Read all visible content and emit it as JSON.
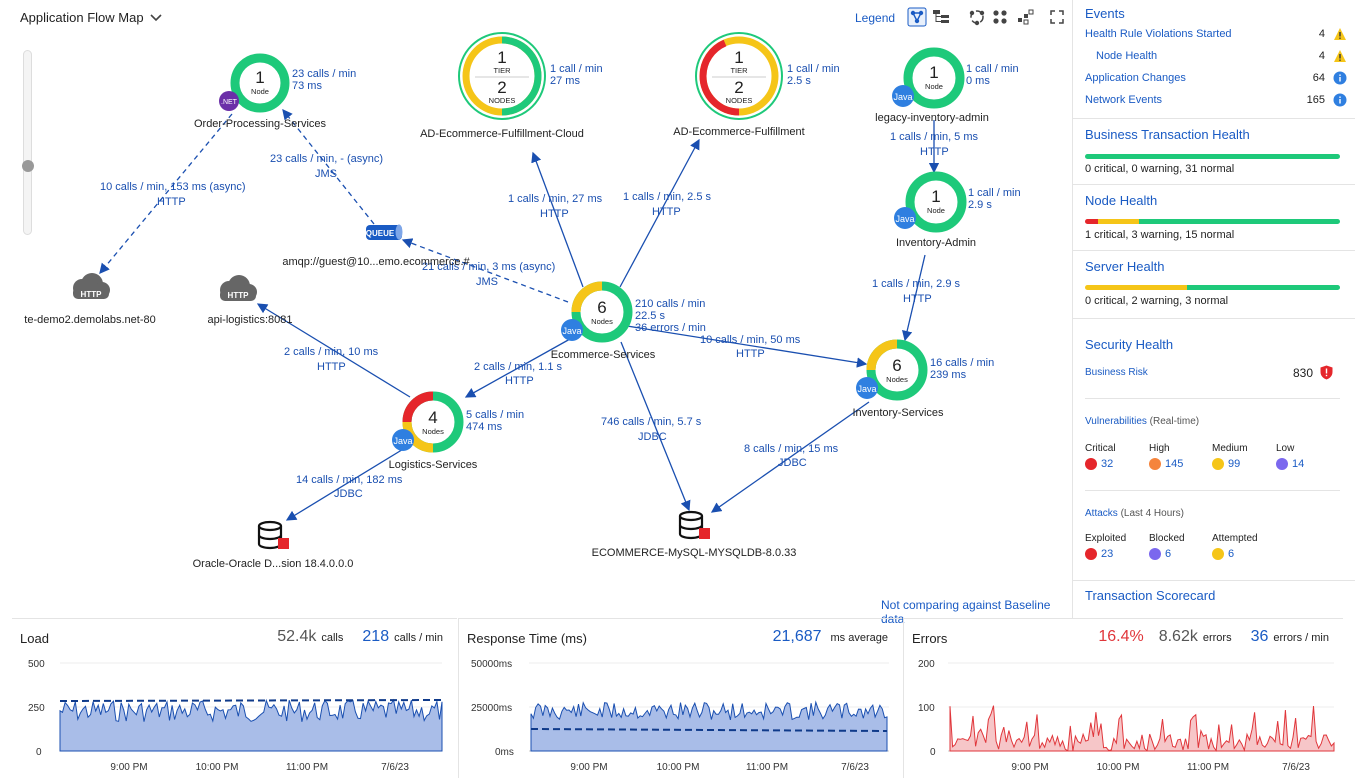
{
  "map": {
    "title": "Application Flow Map",
    "legend": "Legend",
    "baseline_note": "Not comparing against Baseline data",
    "nodes": {
      "order": {
        "count": "1",
        "unit": "Node",
        "name": "Order-Processing-Services",
        "badge": ".NET",
        "stats": [
          "23 calls / min",
          "73 ms"
        ]
      },
      "cloud": {
        "tier": "1",
        "tier_label": "TIER",
        "nodes": "2",
        "nodes_label": "NODES",
        "name": "AD-Ecommerce-Fulfillment-Cloud",
        "stats": [
          "1 call / min",
          "27 ms"
        ]
      },
      "fulfill": {
        "tier": "1",
        "tier_label": "TIER",
        "nodes": "2",
        "nodes_label": "NODES",
        "name": "AD-Ecommerce-Fulfillment",
        "stats": [
          "1 call / min",
          "2.5 s"
        ]
      },
      "legacy": {
        "count": "1",
        "unit": "Node",
        "name": "legacy-inventory-admin",
        "badge": "Java",
        "stats": [
          "1 call / min",
          "0 ms"
        ]
      },
      "invadmin": {
        "count": "1",
        "unit": "Node",
        "name": "Inventory-Admin",
        "badge": "Java",
        "stats": [
          "1 call / min",
          "2.9 s"
        ]
      },
      "ecom": {
        "count": "6",
        "unit": "Nodes",
        "name": "Ecommerce-Services",
        "badge": "Java",
        "stats": [
          "210 calls / min",
          "22.5 s",
          "36 errors / min"
        ]
      },
      "invsvc": {
        "count": "6",
        "unit": "Nodes",
        "name": "Inventory-Services",
        "badge": "Java",
        "stats": [
          "16 calls / min",
          "239 ms"
        ]
      },
      "logistics": {
        "count": "4",
        "unit": "Nodes",
        "name": "Logistics-Services",
        "badge": "Java",
        "stats": [
          "5 calls / min",
          "474 ms"
        ]
      },
      "queue": {
        "label": "QUEUE",
        "name": "amqp://guest@10...emo.ecommerce.#"
      },
      "http1": {
        "label": "HTTP",
        "name": "te-demo2.demolabs.net-80"
      },
      "http2": {
        "label": "HTTP",
        "name": "api-logistics:8081"
      },
      "oracle": {
        "name": "Oracle-Oracle D...sion 18.4.0.0.0"
      },
      "mysql": {
        "name": "ECOMMERCE-MySQL-MYSQLDB-8.0.33"
      }
    },
    "edges": {
      "e1": [
        "10 calls / min, 153 ms (async)",
        "HTTP"
      ],
      "e2": [
        "23 calls / min, - (async)",
        "JMS"
      ],
      "e3": [
        "21 calls / min, 3 ms (async)",
        "JMS"
      ],
      "e4": [
        "1 calls / min, 27 ms",
        "HTTP"
      ],
      "e5": [
        "1 calls / min, 2.5 s",
        "HTTP"
      ],
      "e6": [
        "1 calls / min, 5 ms",
        "HTTP"
      ],
      "e7": [
        "1 calls / min, 2.9 s",
        "HTTP"
      ],
      "e8": [
        "10 calls / min, 50 ms",
        "HTTP"
      ],
      "e9": [
        "2 calls / min, 10 ms",
        "HTTP"
      ],
      "e10": [
        "2 calls / min, 1.1 s",
        "HTTP"
      ],
      "e11": [
        "746 calls / min, 5.7 s",
        "JDBC"
      ],
      "e12": [
        "8 calls / min, 15 ms",
        "JDBC"
      ],
      "e13": [
        "14 calls / min, 182 ms",
        "JDBC"
      ]
    }
  },
  "side": {
    "events_title": "Events",
    "events": [
      {
        "name": "Health Rule Violations Started",
        "count": "4",
        "icon": "warning-icon"
      },
      {
        "name": "Node Health",
        "count": "4",
        "icon": "warning-icon"
      },
      {
        "name": "Application Changes",
        "count": "64",
        "icon": "info-icon"
      },
      {
        "name": "Network Events",
        "count": "165",
        "icon": "info-icon"
      }
    ],
    "bt_health": {
      "title": "Business Transaction Health",
      "text": "0 critical, 0 warning, 31 normal",
      "critical": 0,
      "warning": 0,
      "normal": 31
    },
    "node_health": {
      "title": "Node Health",
      "text": "1 critical, 3 warning, 15 normal",
      "critical": 1,
      "warning": 3,
      "normal": 15
    },
    "server_health": {
      "title": "Server Health",
      "text": "0 critical, 2 warning, 3 normal",
      "critical": 0,
      "warning": 2,
      "normal": 3
    },
    "security": {
      "title": "Security Health",
      "risk_label": "Business Risk",
      "risk_value": "830",
      "vuln_label": "Vulnerabilities",
      "vuln_sub": "(Real-time)",
      "vulns": [
        {
          "label": "Critical",
          "value": "32",
          "color": "#e5262b"
        },
        {
          "label": "High",
          "value": "145",
          "color": "#f5843c"
        },
        {
          "label": "Medium",
          "value": "99",
          "color": "#f5c518"
        },
        {
          "label": "Low",
          "value": "14",
          "color": "#7b68ee"
        }
      ],
      "attacks_label": "Attacks",
      "attacks_sub": "(Last 4 Hours)",
      "attacks": [
        {
          "label": "Exploited",
          "value": "23",
          "color": "#e5262b"
        },
        {
          "label": "Blocked",
          "value": "6",
          "color": "#7b68ee"
        },
        {
          "label": "Attempted",
          "value": "6",
          "color": "#f5c518"
        }
      ]
    },
    "scorecard": {
      "title": "Transaction Scorecard"
    }
  },
  "charts": {
    "load": {
      "title": "Load",
      "total": "52.4k",
      "total_unit": "calls",
      "rate": "218",
      "rate_unit": "calls / min",
      "yticks": [
        "500",
        "250",
        "0"
      ]
    },
    "response": {
      "title": "Response Time (ms)",
      "avg": "21,687",
      "avg_unit": "ms average",
      "yticks": [
        "50000ms",
        "25000ms",
        "0ms"
      ]
    },
    "errors": {
      "title": "Errors",
      "pct": "16.4%",
      "count": "8.62k",
      "count_unit": "errors",
      "rate": "36",
      "rate_unit": "errors / min",
      "yticks": [
        "200",
        "100",
        "0"
      ]
    },
    "xticks": [
      "9:00 PM",
      "10:00 PM",
      "11:00 PM",
      "7/6/23"
    ]
  },
  "colors": {
    "accent": "#1a5bc4",
    "normal": "#1ec97a",
    "warning": "#f5c518",
    "critical": "#e5262b",
    "java": "#2f7fe0",
    "dotnet": "#6b2fa8"
  }
}
